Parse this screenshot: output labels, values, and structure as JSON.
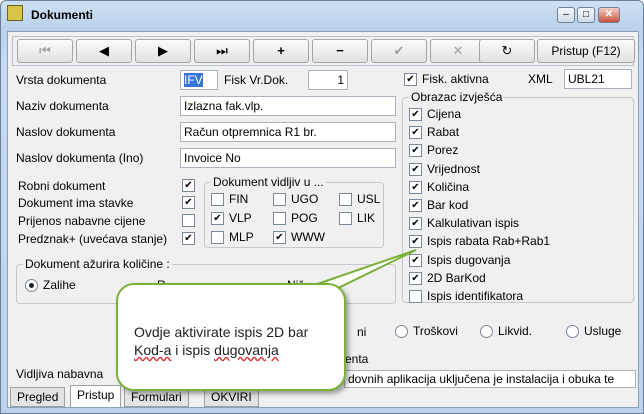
{
  "window": {
    "title": "Dokumenti"
  },
  "toolbar": {
    "first": "⏮",
    "prev": "◀",
    "next": "▶",
    "last": "⏭",
    "add": "+",
    "remove": "−",
    "confirm": "✔",
    "cancel": "✕",
    "refresh": "↻",
    "pristup": "Pristup (F12)"
  },
  "form": {
    "vrsta_label": "Vrsta dokumenta",
    "vrsta_value": "IFV",
    "fisk_vr_label": "Fisk Vr.Dok.",
    "fisk_vr_value": "1",
    "fisk_aktivna_label": "Fisk. aktivna",
    "xml_label": "XML",
    "xml_value": "UBL21",
    "naziv_label": "Naziv dokumenta",
    "naziv_value": "Izlazna fak.vlp.",
    "naslov_label": "Naslov dokumenta",
    "naslov_value": "Račun otpremnica R1 br.",
    "naslov_ino_label": "Naslov dokumenta (Ino)",
    "naslov_ino_value": "Invoice No",
    "robni": "Robni dokument",
    "stavke": "Dokument ima stavke",
    "prijenos": "Prijenos nabavne cijene",
    "predznak": "Predznak+ (uvećava stanje)"
  },
  "vidljiv": {
    "title": "Dokument vidljiv u ...",
    "items": [
      "FIN",
      "UGO",
      "USL",
      "VLP",
      "POG",
      "LIK",
      "MLP",
      "WWW"
    ]
  },
  "azurira": {
    "title": "Dokument ažurira količine :",
    "zalihe": "Zalihe",
    "r2": "R",
    "r3": "Niš"
  },
  "obrazac": {
    "title": "Obrazac izvješća",
    "items": [
      "Cijena",
      "Rabat",
      "Porez",
      "Vrijednost",
      "Količina",
      "Bar kod",
      "Kalkulativan ispis",
      "Ispis rabata Rab+Rab1",
      "Ispis dugovanja",
      "2D BarKod",
      "Ispis identifikatora"
    ]
  },
  "lower": {
    "r_i": "ni",
    "troskovi": "Troškovi",
    "likvid": "Likvid.",
    "usluge": "Usluge",
    "vidljiva": "Vidljiva nabavna",
    "enta": "enta",
    "long": "dovnih aplikacija uključena je instalacija i obuka te"
  },
  "tabs": [
    "Pregled",
    "Pristup",
    "Formulari",
    "OKVIRI"
  ],
  "bubble": {
    "line1": "Ovdje aktivirate ispis 2D bar",
    "line2a": "Kod-a",
    "line2b": " i ispis ",
    "line2c": "dugovanja"
  }
}
